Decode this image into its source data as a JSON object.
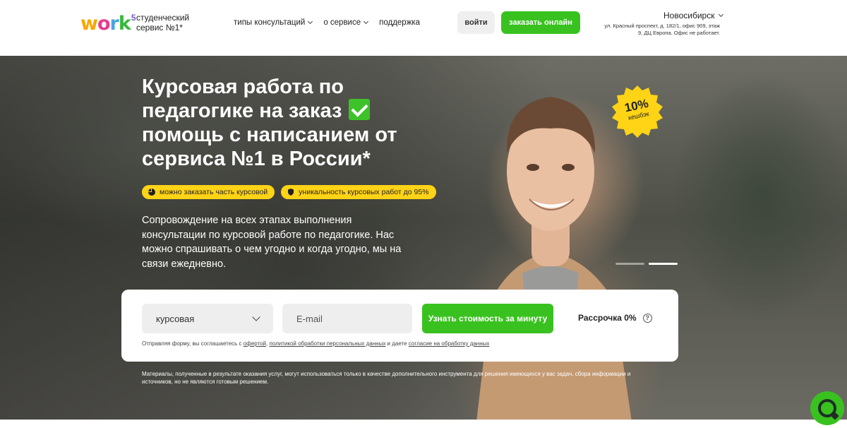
{
  "header": {
    "logo_text": "work",
    "logo_sup": "5",
    "slogan": "студенческий сервис №1*",
    "nav": [
      {
        "label": "типы консультаций",
        "has_dropdown": true
      },
      {
        "label": "о сервисе",
        "has_dropdown": true
      },
      {
        "label": "поддержка",
        "has_dropdown": false
      }
    ],
    "login_label": "войти",
    "order_label": "заказать онлайн",
    "city": "Новосибирск",
    "address": "ул. Красный проспект, д. 182/1, офис 909, этаж 9, ДЦ Европа. Офис не работает."
  },
  "hero": {
    "title": "Курсовая работа по педагогике на заказ",
    "title_rest": "помощь с написанием от сервиса №1 в России*",
    "badges": [
      {
        "icon": "pie-chart-icon",
        "label": "можно заказать часть курсовой"
      },
      {
        "icon": "shield-icon",
        "label": "уникальность курсовых работ до 95%"
      }
    ],
    "lead": "Сопровождение на всех этапах выполнения консультации по курсовой работе по педагогике. Нас можно спрашивать о чем угодно и когда угодно, мы на связи ежедневно.",
    "cashback_pct": "10%",
    "cashback_label": "кешбэк",
    "slider": {
      "slides": 2,
      "active": 2
    }
  },
  "form": {
    "select_value": "курсовая",
    "email_placeholder": "E-mail",
    "submit_label": "Узнать стоимость за минуту",
    "installment_label": "Рассрочка 0%",
    "help_glyph": "?",
    "agree_prefix": "Отправляя форму, вы соглашаетесь с",
    "agree_link1": "офертой",
    "agree_sep": ",",
    "agree_link2": "политикой обработки персональных данных",
    "agree_mid": "и даете",
    "agree_link3": "согласие на обработку данных"
  },
  "disclaimer": "Материалы, полученные в результате оказания услуг, могут использоваться только в качестве дополнительного инструмента для решения имеющихся у вас задач, сбора информации и источников, но не являются готовым решением.",
  "colors": {
    "accent_green": "#39c21f",
    "badge_yellow": "#ffd316",
    "button_gray": "#efefef"
  }
}
